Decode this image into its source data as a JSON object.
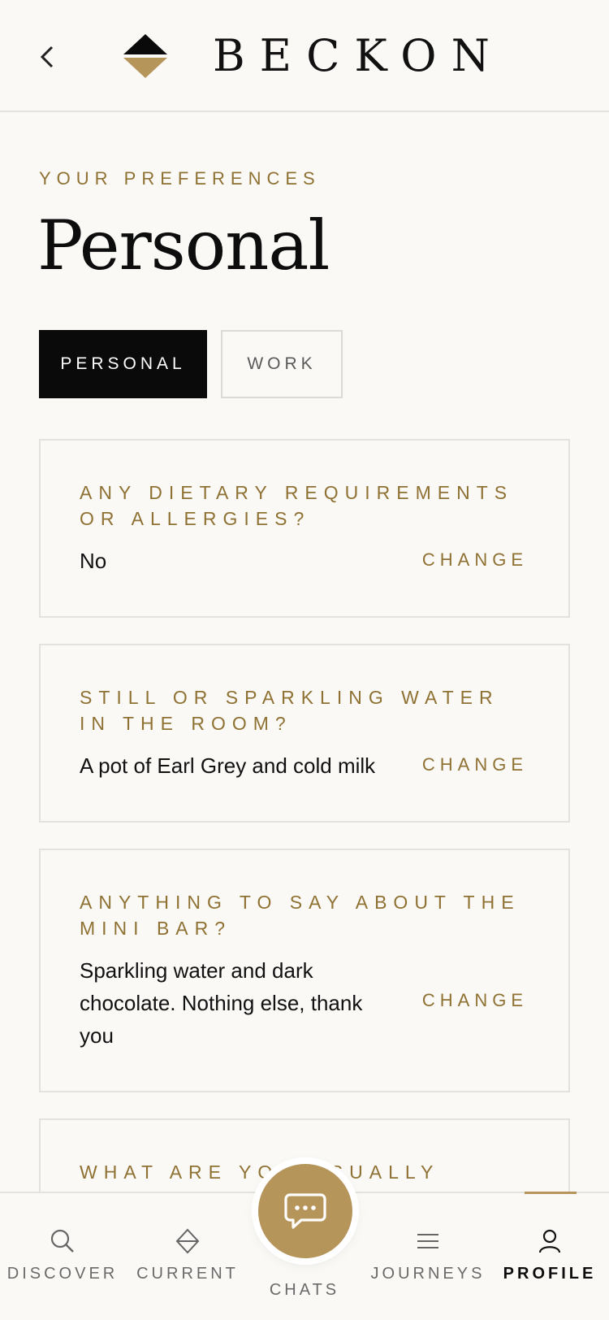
{
  "header": {
    "brand": "BECKON"
  },
  "eyebrow": "YOUR PREFERENCES",
  "title": "Personal",
  "tabs": [
    {
      "label": "PERSONAL",
      "active": true
    },
    {
      "label": "WORK",
      "active": false
    }
  ],
  "cards": [
    {
      "question": "ANY DIETARY REQUIREMENTS OR ALLERGIES?",
      "answer": "No",
      "action": "CHANGE"
    },
    {
      "question": "STILL OR SPARKLING WATER IN THE ROOM?",
      "answer": "A pot of Earl Grey and cold milk",
      "action": "CHANGE"
    },
    {
      "question": "ANYTHING TO SAY ABOUT THE MINI BAR?",
      "answer": "Sparkling water and dark chocolate. Nothing else, thank you",
      "action": "CHANGE"
    },
    {
      "question": "WHAT ARE YOU USUALLY"
    }
  ],
  "nav": [
    {
      "label": "DISCOVER",
      "icon": "search-icon"
    },
    {
      "label": "CURRENT",
      "icon": "diamond-icon"
    },
    {
      "label": "CHATS",
      "icon": "chat-icon"
    },
    {
      "label": "JOURNEYS",
      "icon": "menu-icon"
    },
    {
      "label": "PROFILE",
      "icon": "user-icon",
      "active": true
    }
  ],
  "colors": {
    "accent": "#b6955b",
    "gold_text": "#8f7233",
    "background": "#faf9f6",
    "dark": "#0a0a0a"
  }
}
